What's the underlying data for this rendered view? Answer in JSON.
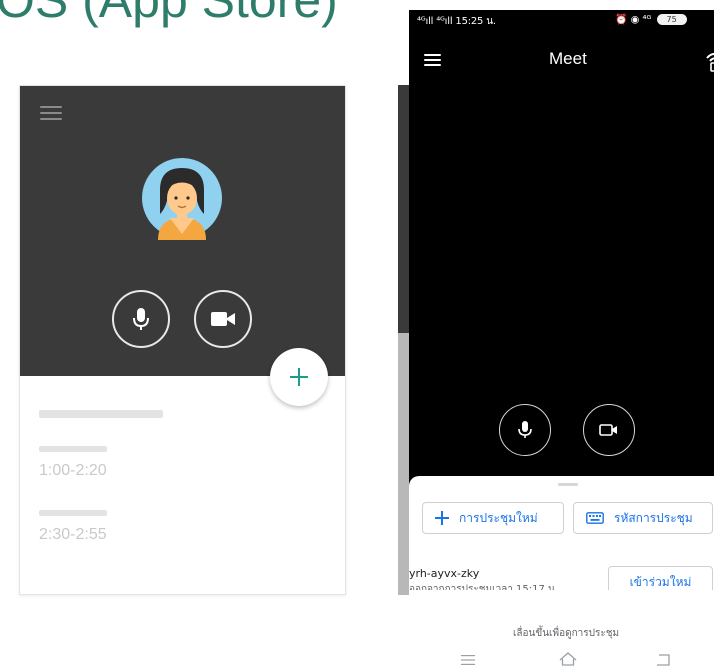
{
  "header": {
    "heading_fragment": "OS (App Store)"
  },
  "left_mock": {
    "times": [
      "1:00-2:20",
      "2:30-2:55"
    ],
    "icons": [
      "menu-icon",
      "avatar-icon",
      "microphone-icon",
      "camera-icon",
      "plus-icon"
    ],
    "accent_color": "#1a9e8a"
  },
  "status_bar": {
    "left": "⁴ᴳıll ⁴ᴳıll 15:25 น.",
    "right": "⏰ ◉ ⁴ᴳ",
    "battery": "75"
  },
  "app": {
    "title": "Meet",
    "new_meeting_label": "การประชุมใหม่",
    "meeting_code_label": "รหัสการประชุม",
    "recent_code": "yrh-ayvx-zky",
    "recent_subtitle": "ออกจากการประชุมเวลา 15:17 น.",
    "rejoin_label": "เข้าร่วมใหม่",
    "swipe_hint": "เลื่อนขึ้นเพื่อดูการประชุม",
    "accent_color": "#1a73e8"
  }
}
